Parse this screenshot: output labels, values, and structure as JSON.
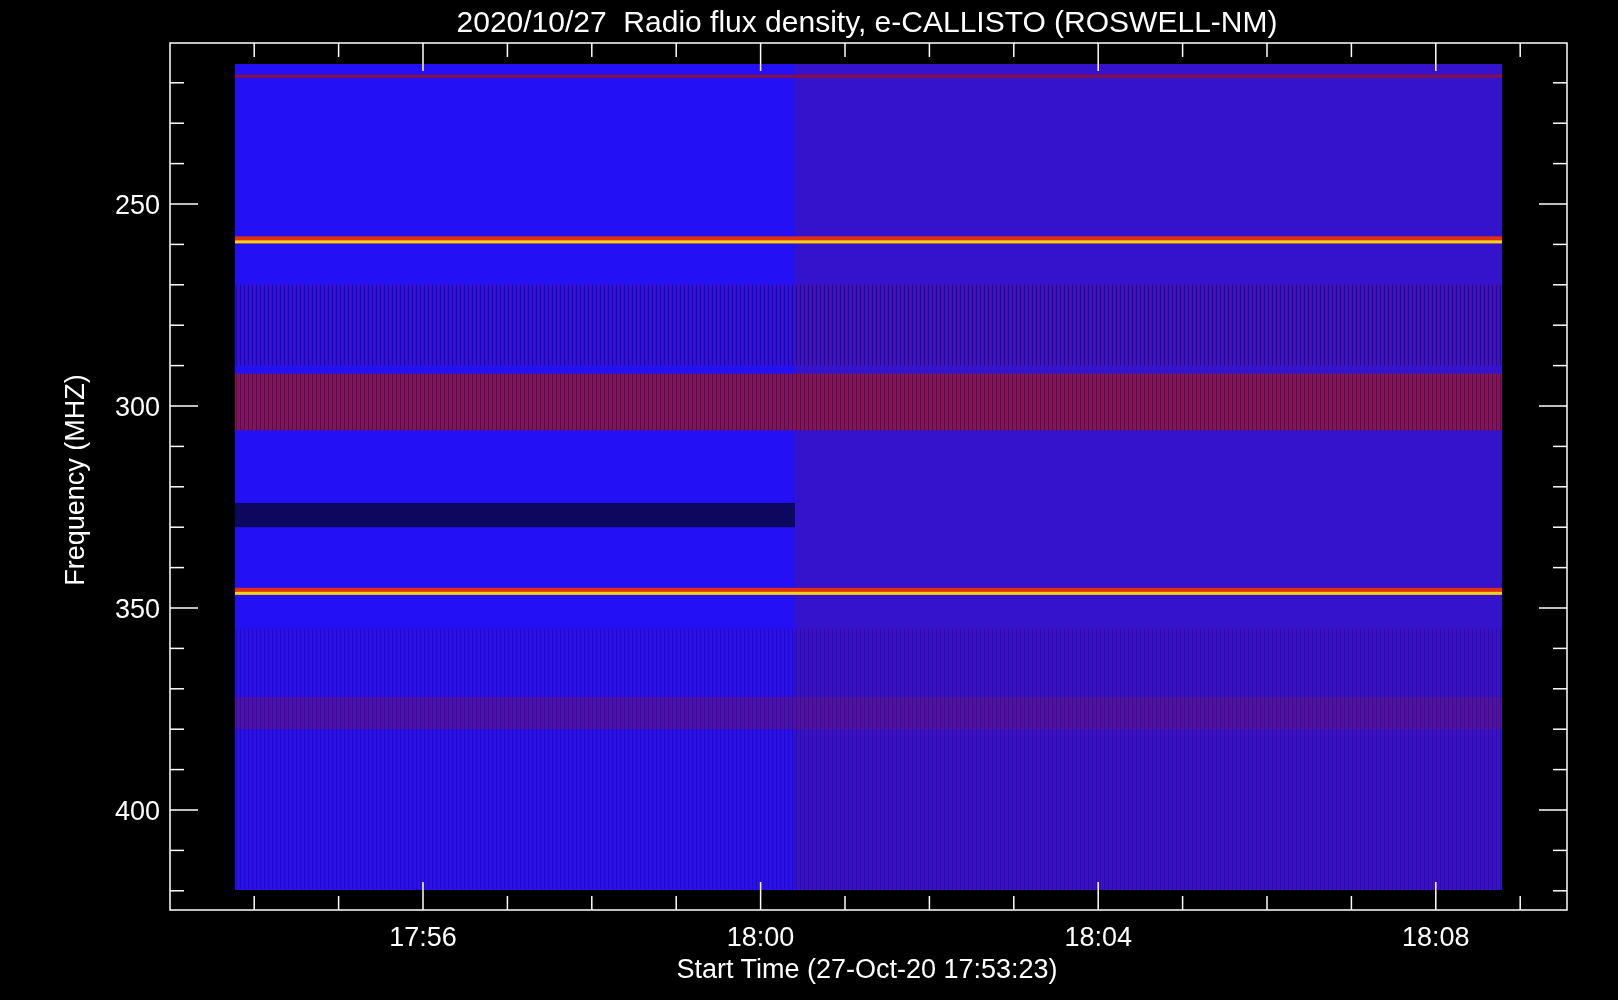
{
  "title": "2020/10/27  Radio flux density, e-CALLISTO (ROSWELL-NM)",
  "x_axis": {
    "label": "Start Time (27-Oct-20 17:53:23)",
    "ticks": [
      "17:56",
      "18:00",
      "18:04",
      "18:08"
    ]
  },
  "y_axis": {
    "label": "Frequency (MHZ)",
    "ticks": [
      "250",
      "300",
      "350",
      "400"
    ]
  }
}
